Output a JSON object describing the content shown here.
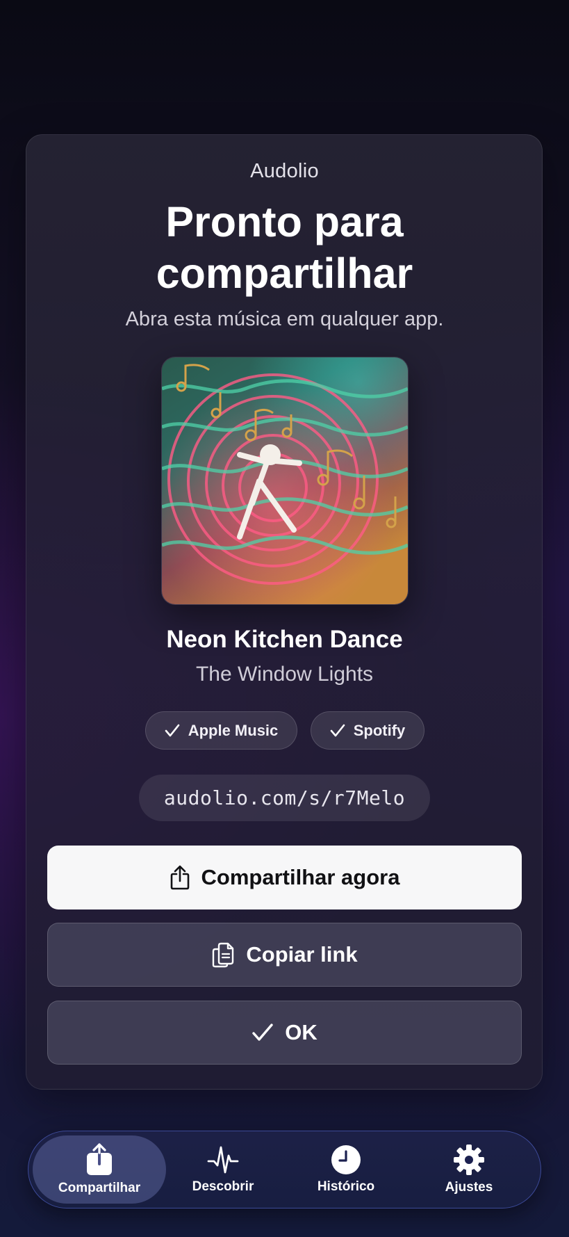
{
  "app_name": "Audolio",
  "title": "Pronto para compartilhar",
  "subtitle": "Abra esta música em qualquer app.",
  "track": {
    "title": "Neon Kitchen Dance",
    "artist": "The Window Lights",
    "artwork_icon": "dancing-figure-artwork"
  },
  "services": [
    {
      "label": "Apple Music",
      "icon": "checkmark-icon"
    },
    {
      "label": "Spotify",
      "icon": "checkmark-icon"
    }
  ],
  "share_link": "audolio.com/s/r7Melo",
  "buttons": {
    "share_now": "Compartilhar agora",
    "copy_link": "Copiar link",
    "ok": "OK"
  },
  "tabs": [
    {
      "label": "Compartilhar",
      "icon": "share-icon",
      "active": true
    },
    {
      "label": "Descobrir",
      "icon": "waveform-icon",
      "active": false
    },
    {
      "label": "Histórico",
      "icon": "clock-icon",
      "active": false
    },
    {
      "label": "Ajustes",
      "icon": "gear-icon",
      "active": false
    }
  ],
  "colors": {
    "primary_button_bg": "#f7f7f8",
    "tabbar_border": "#5a6edc"
  }
}
